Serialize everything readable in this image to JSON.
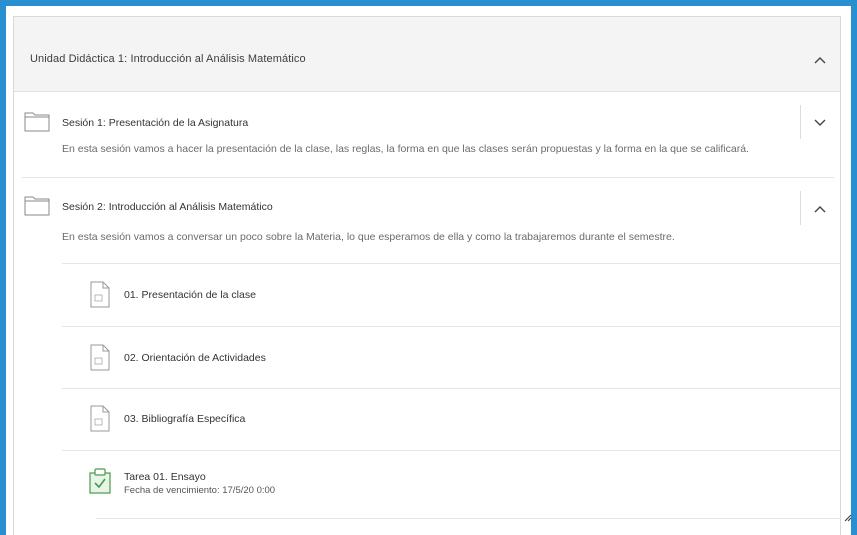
{
  "unit": {
    "title": "Unidad Didáctica 1: Introducción al Análisis Matemático"
  },
  "sessions": [
    {
      "title": "Sesión 1: Presentación de la Asignatura",
      "description": "En esta sesión vamos a hacer la presentación de la clase, las reglas, la forma en que las clases serán propuestas y la forma en la que se calificará."
    },
    {
      "title": "Sesión 2: Introducción al Análisis Matemático",
      "description": "En esta sesión vamos a conversar un poco sobre la Materia, lo que esperamos de ella y como la trabajaremos durante el semestre."
    }
  ],
  "items": [
    {
      "label": "01. Presentación de la clase"
    },
    {
      "label": "02. Orientación de Actividades"
    },
    {
      "label": "03. Bibliografía Específica"
    }
  ],
  "task": {
    "title": "Tarea 01. Ensayo",
    "due_label": "Fecha de vencimiento:",
    "due_date": "17/5/20 0:00"
  },
  "icons": {
    "unit_toggle": "chevron-up-icon",
    "session1_toggle": "chevron-down-icon",
    "session2_toggle": "chevron-up-icon",
    "folder": "folder-icon",
    "document": "document-icon",
    "assignment": "assignment-icon",
    "resize": "resize-handle-icon"
  },
  "colors": {
    "frame": "#2a8fd1",
    "header_bg": "#f4f4f4",
    "assignment_icon": "#4a9a4a"
  }
}
